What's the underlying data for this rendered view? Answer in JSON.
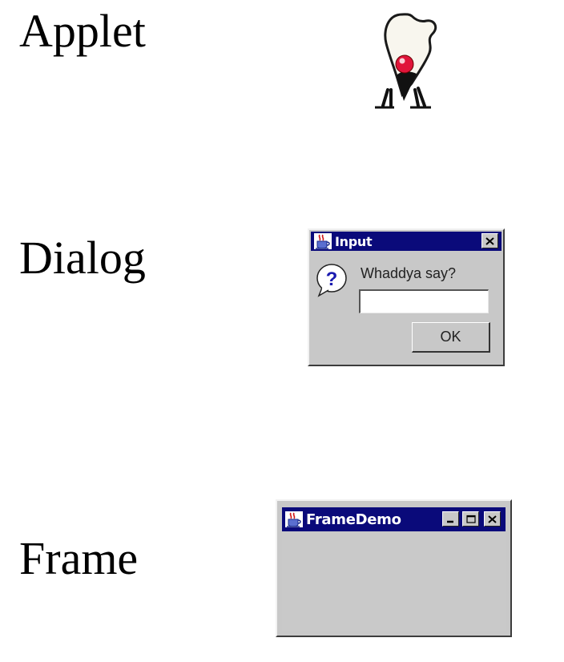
{
  "captions": {
    "applet": "Applet",
    "dialog": "Dialog",
    "frame": "Frame"
  },
  "applet": {
    "mascot": "duke-icon"
  },
  "dialog": {
    "title": "Input",
    "icon": "question-icon",
    "prompt": "Whaddya say?",
    "input_value": "",
    "ok_label": "OK",
    "close_icon": "close-icon"
  },
  "frame": {
    "title": "FrameDemo",
    "controls": [
      "minimize-icon",
      "maximize-icon",
      "close-icon"
    ]
  },
  "colors": {
    "titlebar": "#0a0a7a",
    "window_bg": "#c8c8c8",
    "page_bg": "#ffffff"
  }
}
